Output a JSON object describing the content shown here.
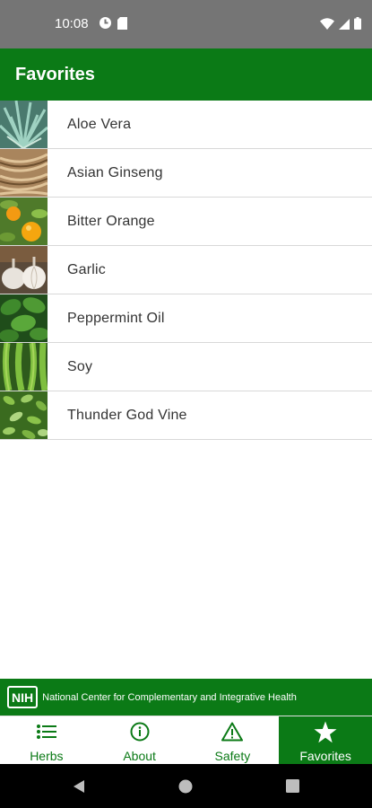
{
  "status_bar": {
    "time": "10:08"
  },
  "app_bar": {
    "title": "Favorites"
  },
  "favorites": [
    {
      "label": "Aloe Vera",
      "thumb": "aloe-vera-thumbnail"
    },
    {
      "label": "Asian Ginseng",
      "thumb": "asian-ginseng-thumbnail"
    },
    {
      "label": "Bitter Orange",
      "thumb": "bitter-orange-thumbnail"
    },
    {
      "label": "Garlic",
      "thumb": "garlic-thumbnail"
    },
    {
      "label": "Peppermint Oil",
      "thumb": "peppermint-oil-thumbnail"
    },
    {
      "label": "Soy",
      "thumb": "soy-thumbnail"
    },
    {
      "label": "Thunder God Vine",
      "thumb": "thunder-god-vine-thumbnail"
    }
  ],
  "banner": {
    "logo": "NIH",
    "text": "National Center for Complementary and Integrative Health"
  },
  "bottom_nav": {
    "items": [
      {
        "label": "Herbs",
        "icon": "list-icon",
        "active": false
      },
      {
        "label": "About",
        "icon": "info-icon",
        "active": false
      },
      {
        "label": "Safety",
        "icon": "warning-icon",
        "active": false
      },
      {
        "label": "Favorites",
        "icon": "star-icon",
        "active": true
      }
    ]
  },
  "colors": {
    "primary_green": "#0b7a16",
    "status_bar_gray": "#757575",
    "text": "#333333"
  }
}
